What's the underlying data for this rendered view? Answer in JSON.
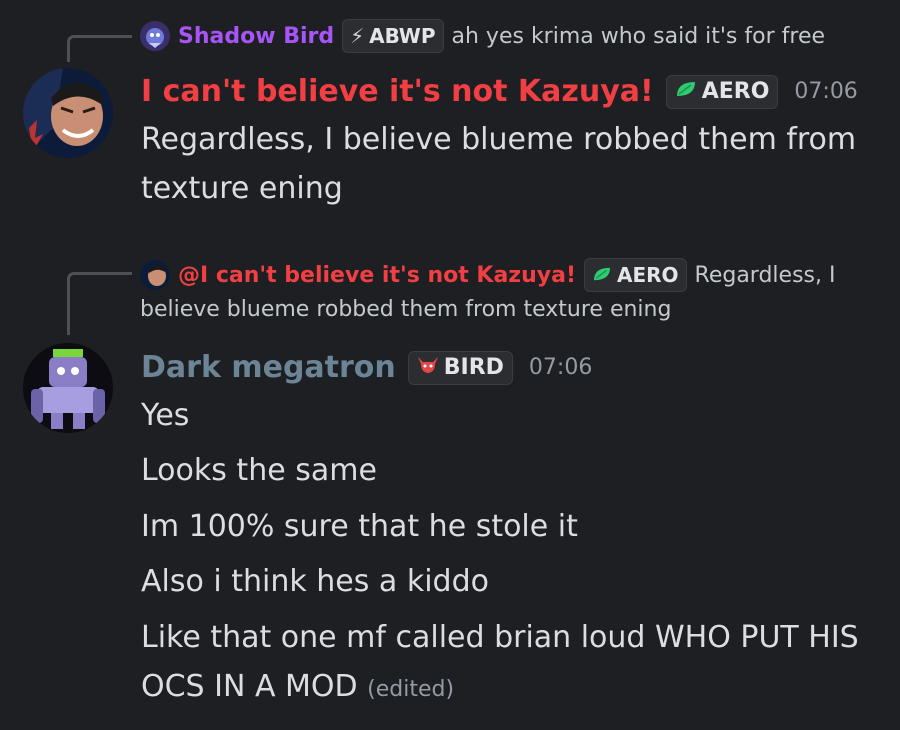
{
  "messages": [
    {
      "reply": {
        "author": "Shadow Bird",
        "author_color": "#a855f7",
        "tag": "ABWP",
        "text": "ah yes krima who said it's for free"
      },
      "author": "I can't believe it's not Kazuya!",
      "author_color": "#f23f43",
      "tag": "AERO",
      "time": "07:06",
      "lines": [
        "Regardless, I believe blueme robbed them from",
        "texture ening"
      ]
    },
    {
      "reply": {
        "author": "@I can't believe it's not Kazuya!",
        "author_color": "#f23f43",
        "tag": "AERO",
        "text_line1": "Regardless, I",
        "text_line2": "believe blueme robbed them from texture ening"
      },
      "author": "Dark megatron",
      "author_color": "#6b8596",
      "tag": "BIRD",
      "time": "07:06",
      "lines": [
        "Yes",
        "Looks the same",
        "Im 100% sure that he stole it",
        "Also i think hes a kiddo",
        "Like that one mf called brian loud WHO PUT HIS",
        "OCS IN A MOD"
      ],
      "edited": "(edited)"
    }
  ]
}
